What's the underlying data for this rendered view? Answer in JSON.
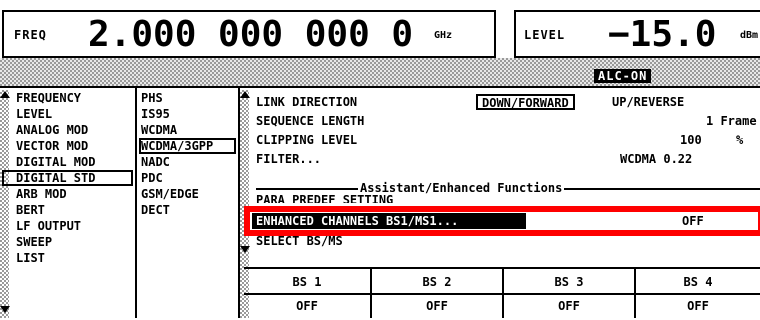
{
  "header": {
    "freq": {
      "label": "FREQ",
      "value": "2.000 000 000 0",
      "unit": "GHz"
    },
    "level": {
      "label": "LEVEL",
      "value": "−15.0",
      "unit": "dBm"
    },
    "status_badge": "ALC-ON"
  },
  "menu_main": {
    "items": [
      {
        "label": "FREQUENCY"
      },
      {
        "label": "LEVEL"
      },
      {
        "label": "ANALOG MOD"
      },
      {
        "label": "VECTOR MOD"
      },
      {
        "label": "DIGITAL MOD"
      },
      {
        "label": "DIGITAL STD"
      },
      {
        "label": "ARB MOD"
      },
      {
        "label": "BERT"
      },
      {
        "label": "LF OUTPUT"
      },
      {
        "label": "SWEEP"
      },
      {
        "label": "LIST"
      }
    ],
    "selected": "DIGITAL STD"
  },
  "menu_std": {
    "items": [
      {
        "label": "PHS"
      },
      {
        "label": "IS95"
      },
      {
        "label": "WCDMA"
      },
      {
        "label": "WCDMA/3GPP"
      },
      {
        "label": "NADC"
      },
      {
        "label": "PDC"
      },
      {
        "label": "GSM/EDGE"
      },
      {
        "label": "DECT"
      }
    ],
    "selected": "WCDMA/3GPP"
  },
  "panel": {
    "link_direction": {
      "label": "LINK DIRECTION",
      "option_selected": "DOWN/FORWARD",
      "option_other": "UP/REVERSE"
    },
    "sequence_length": {
      "label": "SEQUENCE LENGTH",
      "value": "1 Frame"
    },
    "clipping_level": {
      "label": "CLIPPING LEVEL",
      "value": "100",
      "unit": "%"
    },
    "filter": {
      "label": "FILTER...",
      "value": "WCDMA 0.22"
    },
    "section_title": "Assistant/Enhanced Functions",
    "partial_row": "PARA PREDEF SETTING",
    "enhanced_channels": {
      "label": "ENHANCED CHANNELS BS1/MS1...",
      "value": "OFF"
    },
    "select_bs_ms": {
      "label": "SELECT BS/MS"
    }
  },
  "bs_table": [
    {
      "name": "BS 1",
      "state": "OFF"
    },
    {
      "name": "BS 2",
      "state": "OFF"
    },
    {
      "name": "BS 3",
      "state": "OFF"
    },
    {
      "name": "BS 4",
      "state": "OFF"
    }
  ]
}
